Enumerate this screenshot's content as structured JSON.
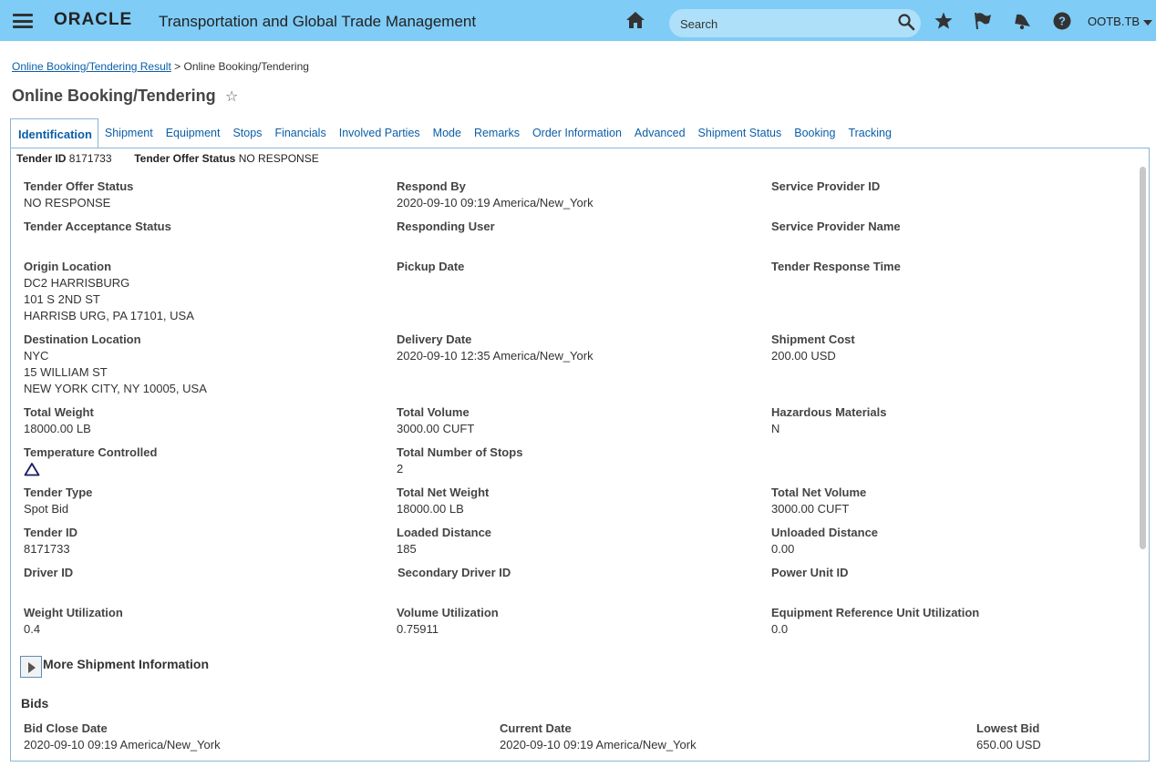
{
  "header": {
    "brand": "ORACLE",
    "app_title": "Transportation and Global Trade Management",
    "search_placeholder": "Search",
    "user": "OOTB.TB"
  },
  "breadcrumb": {
    "link": "Online Booking/Tendering Result",
    "separator": ">",
    "current": "Online Booking/Tendering"
  },
  "page_title": "Online Booking/Tendering",
  "tabs": [
    "Identification",
    "Shipment",
    "Equipment",
    "Stops",
    "Financials",
    "Involved Parties",
    "Mode",
    "Remarks",
    "Order Information",
    "Advanced",
    "Shipment Status",
    "Booking",
    "Tracking"
  ],
  "summary": {
    "tender_id_label": "Tender ID",
    "tender_id_value": "8171733",
    "offer_status_label": "Tender Offer Status",
    "offer_status_value": "NO RESPONSE"
  },
  "fields": {
    "tender_offer_status": {
      "label": "Tender Offer Status",
      "value": "NO RESPONSE"
    },
    "respond_by": {
      "label": "Respond By",
      "value": "2020-09-10 09:19 America/New_York"
    },
    "service_provider_id": {
      "label": "Service Provider ID",
      "value": ""
    },
    "tender_acceptance_status": {
      "label": "Tender Acceptance Status",
      "value": ""
    },
    "responding_user": {
      "label": "Responding User",
      "value": ""
    },
    "service_provider_name": {
      "label": "Service Provider Name",
      "value": ""
    },
    "origin_location": {
      "label": "Origin Location",
      "line1": "DC2 HARRISBURG",
      "line2": "101 S 2ND ST",
      "line3": "HARRISB URG, PA 17101, USA"
    },
    "pickup_date": {
      "label": "Pickup Date",
      "value": ""
    },
    "tender_response_time": {
      "label": "Tender Response Time",
      "value": ""
    },
    "destination_location": {
      "label": "Destination Location",
      "line1": "NYC",
      "line2": "15 WILLIAM ST",
      "line3": "NEW YORK CITY, NY 10005, USA"
    },
    "delivery_date": {
      "label": "Delivery Date",
      "value": "2020-09-10 12:35 America/New_York"
    },
    "shipment_cost": {
      "label": "Shipment Cost",
      "value": "200.00 USD"
    },
    "total_weight": {
      "label": "Total Weight",
      "value": "18000.00 LB"
    },
    "total_volume": {
      "label": "Total Volume",
      "value": "3000.00 CUFT"
    },
    "hazardous_materials": {
      "label": "Hazardous Materials",
      "value": "N"
    },
    "temperature_controlled": {
      "label": "Temperature Controlled",
      "icon": "warning-triangle-icon"
    },
    "total_number_of_stops": {
      "label": "Total Number of Stops",
      "value": "2"
    },
    "tender_type": {
      "label": "Tender Type",
      "value": "Spot Bid"
    },
    "total_net_weight": {
      "label": "Total Net Weight",
      "value": "18000.00 LB"
    },
    "total_net_volume": {
      "label": "Total Net Volume",
      "value": "3000.00 CUFT"
    },
    "tender_id": {
      "label": "Tender ID",
      "value": "8171733"
    },
    "loaded_distance": {
      "label": "Loaded Distance",
      "value": "185"
    },
    "unloaded_distance": {
      "label": "Unloaded Distance",
      "value": "0.00"
    },
    "driver_id": {
      "label": "Driver ID",
      "value": ""
    },
    "secondary_driver_id": {
      "label": "Secondary Driver ID",
      "value": ""
    },
    "power_unit_id": {
      "label": "Power Unit ID",
      "value": ""
    },
    "weight_utilization": {
      "label": "Weight Utilization",
      "value": "0.4"
    },
    "volume_utilization": {
      "label": "Volume Utilization",
      "value": "0.75911"
    },
    "equipment_ref_unit_utilization": {
      "label": "Equipment Reference Unit Utilization",
      "value": "0.0"
    }
  },
  "more_info_label": "More Shipment Information",
  "bids": {
    "title": "Bids",
    "bid_close_date": {
      "label": "Bid Close Date",
      "value": "2020-09-10 09:19 America/New_York"
    },
    "current_date": {
      "label": "Current Date",
      "value": "2020-09-10 09:19 America/New_York"
    },
    "lowest_bid": {
      "label": "Lowest Bid",
      "value": "650.00 USD"
    }
  },
  "colors": {
    "header_bg": "#7fccf6",
    "link": "#0b5ea8",
    "panel_border": "#8ab6d6"
  }
}
